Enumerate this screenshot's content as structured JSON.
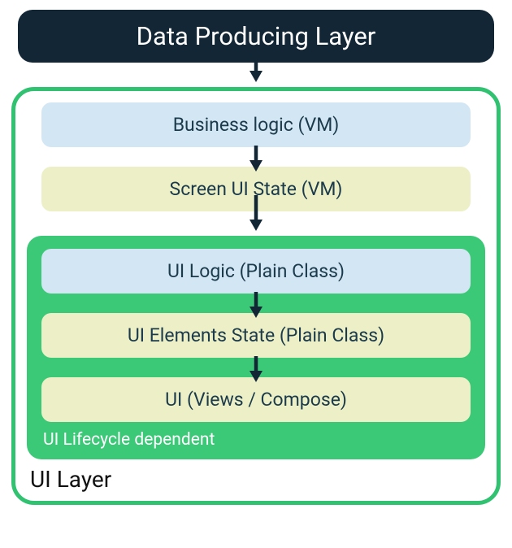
{
  "top": {
    "title": "Data Producing Layer"
  },
  "outer": {
    "label": "UI Layer",
    "box1": "Business logic (VM)",
    "box2": "Screen UI State (VM)"
  },
  "inner": {
    "label": "UI Lifecycle dependent",
    "box1": "UI Logic (Plain Class)",
    "box2": "UI Elements State (Plain Class)",
    "box3": "UI (Views / Compose)"
  },
  "colors": {
    "arrow": "#122636"
  }
}
